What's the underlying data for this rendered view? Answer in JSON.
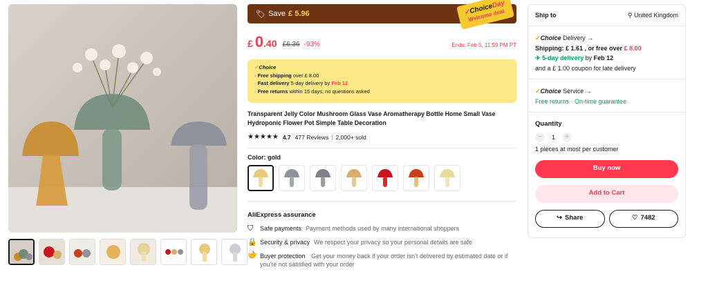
{
  "gallery": {
    "main_image": "mushroom-glass-vases-photo",
    "thumbnails": [
      "thumb-1",
      "thumb-2",
      "thumb-3",
      "thumb-4",
      "thumb-5",
      "thumb-6",
      "thumb-7",
      "thumb-8"
    ],
    "next_icon": "chevron-right-icon"
  },
  "promo": {
    "save_label": "Save",
    "save_amount": "£ 5.96",
    "badge_choice": "Choice",
    "badge_day": "Day",
    "badge_sub": "Welcome deal"
  },
  "price": {
    "currency": "£",
    "integer": "0",
    "decimal": ".40",
    "original": "£6.36",
    "discount": "-93%",
    "ends": "Ends: Feb 5, 11:59 PM PT"
  },
  "choice_box": {
    "title": "Choice",
    "line1_bold": "Free shipping",
    "line1_rest": " over  £ 8.00",
    "line2_bold": "Fast delivery",
    "line2_rest": " 5-day delivery by ",
    "line2_date": "Feb 12",
    "line3_bold": "Free returns",
    "line3_rest": "  within 15 days, no questions asked"
  },
  "product": {
    "title": "Transparent Jelly Color Mushroom Glass Vase Aromatherapy Bottle Home Small Vase Hydroponic Flower Pot Simple Table Decoration",
    "stars": "★★★★★",
    "rating": "4.7",
    "reviews": "477 Reviews",
    "sold": "2,000+ sold",
    "color_label": "Color: gold"
  },
  "swatches": [
    {
      "name": "gold",
      "cap": "#e7c97a",
      "stem": "#f1dba0"
    },
    {
      "name": "grey",
      "cap": "#8f9397",
      "stem": "#a4a8ab"
    },
    {
      "name": "silver",
      "cap": "#7e8286",
      "stem": "#9a9ea2"
    },
    {
      "name": "amber",
      "cap": "#d6b06a",
      "stem": "#e4cb92"
    },
    {
      "name": "red",
      "cap": "#c8161c",
      "stem": "#d62a2f"
    },
    {
      "name": "red-gold",
      "cap": "#c8401c",
      "stem": "#e0c07a"
    },
    {
      "name": "pale-yellow",
      "cap": "#e5dc9c",
      "stem": "#eee7b8"
    }
  ],
  "assurance": {
    "title": "AliExpress assurance",
    "items": [
      {
        "label": "Safe payments",
        "desc": "Payment methods used by many international shoppers"
      },
      {
        "label": "Security & privacy",
        "desc": "We respect your privacy so your personal details are safe"
      },
      {
        "label": "Buyer protection",
        "desc": "Get your money back if your order isn't delivered by estimated date or if you're not satisfied with your order"
      }
    ]
  },
  "sidebar": {
    "ship_to_label": "Ship to",
    "ship_to_value": "United Kingdom",
    "delivery_choice": "Choice",
    "delivery_label": " Delivery →",
    "shipping_label": "Shipping: ",
    "shipping_value": "£ 1.61 , or free over ",
    "shipping_free": "£ 8.00",
    "fast_delivery": "5-day delivery",
    "fast_by": " by ",
    "fast_date": "Feb 12",
    "coupon": "and a  £ 1.00 coupon for late delivery",
    "service_choice": "Choice",
    "service_label": " Service →",
    "free_returns": "Free returns",
    "dot": " · ",
    "on_time": "On-time guarantee",
    "quantity_label": "Quantity",
    "quantity_minus": "−",
    "quantity_value": "1",
    "quantity_plus": "+",
    "quantity_note": "1 pieces at most per customer",
    "buy_now": "Buy now",
    "add_to_cart": "Add to Cart",
    "share": "Share",
    "wishlist_count": "7482"
  }
}
